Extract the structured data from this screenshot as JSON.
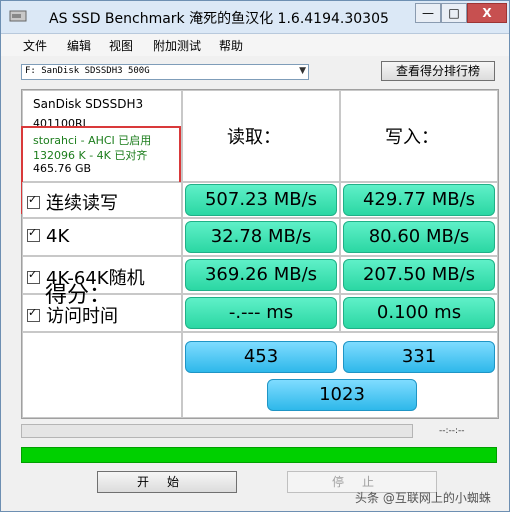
{
  "window": {
    "title": "AS SSD Benchmark 淹死的鱼汉化 1.6.4194.30305",
    "controls": {
      "minimize": "—",
      "maximize": "□",
      "close": "X"
    }
  },
  "menu": [
    "文件",
    "编辑",
    "视图",
    "附加测试",
    "帮助"
  ],
  "drive_select": {
    "value": "F: SanDisk SDSSDH3 500G"
  },
  "rank_button": "查看得分排行榜",
  "info": {
    "model": "SanDisk SDSSDH3",
    "firmware": "401100RL",
    "driver": "storahci - AHCI 已启用",
    "alignment": "132096 K - 4K 已对齐",
    "size": "465.76 GB"
  },
  "headers": {
    "read": "读取：",
    "write": "写入："
  },
  "rows": [
    {
      "label": "连续读写",
      "read": "507.23 MB/s",
      "write": "429.77 MB/s"
    },
    {
      "label": "4K",
      "read": "32.78 MB/s",
      "write": "80.60 MB/s"
    },
    {
      "label": "4K-64K随机",
      "read": "369.26 MB/s",
      "write": "207.50 MB/s"
    },
    {
      "label": "访问时间",
      "read": "-.--- ms",
      "write": "0.100 ms"
    }
  ],
  "score": {
    "label": "得分：",
    "read": "453",
    "write": "331",
    "total": "1023"
  },
  "time_readout": "--:--:--",
  "progress_fraction": 0,
  "buttons": {
    "start": "开始",
    "stop": "停止"
  },
  "watermark": "头条 @互联网上的小蜘蛛",
  "colors": {
    "value_box": "#2bd7a3",
    "score_box": "#2eb8ea",
    "highlight_border": "#d9393a",
    "green_bar": "#00d000"
  }
}
